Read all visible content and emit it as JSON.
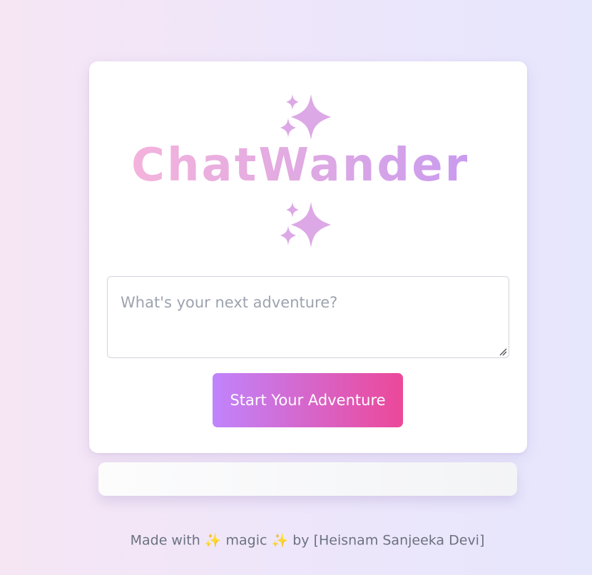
{
  "app": {
    "title": "ChatWander"
  },
  "prompt": {
    "placeholder": "What's your next adventure?",
    "value": ""
  },
  "actions": {
    "start_label": "Start Your Adventure"
  },
  "result": {
    "text": ""
  },
  "footer": {
    "made_with": "Made with",
    "sparkle": "✨",
    "magic": "magic",
    "by": "by [Heisnam Sanjeeka Devi]"
  },
  "colors": {
    "sparkle": "#dda8e6",
    "button_start": "#c084fc",
    "button_end": "#ec4899",
    "title_start": "#f4b3dc",
    "title_end": "#c99bef"
  },
  "icons": {
    "decoration_top": "sparkles-icon",
    "decoration_bottom": "sparkles-icon"
  }
}
